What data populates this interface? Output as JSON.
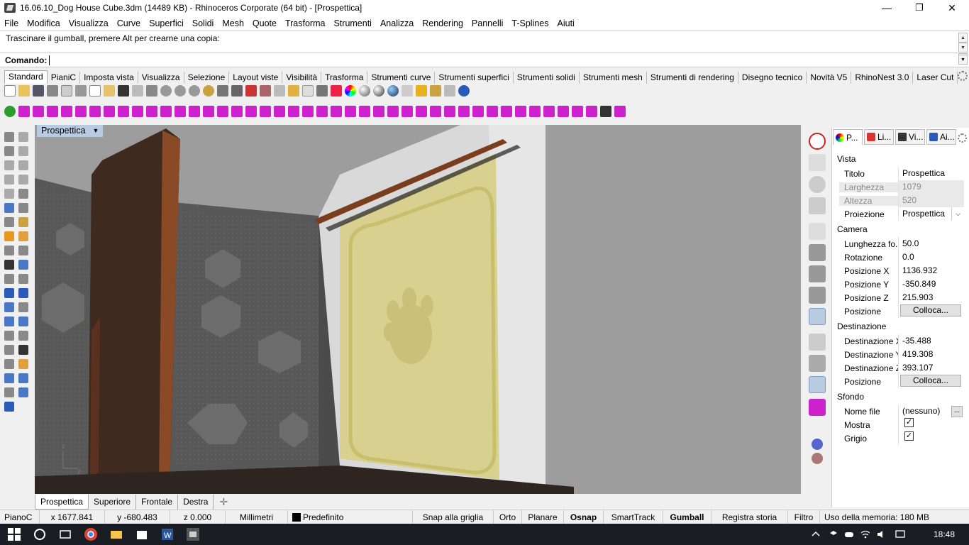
{
  "window": {
    "title": "16.06.10_Dog House Cube.3dm (14489 KB) - Rhinoceros Corporate (64 bit) - [Prospettica]",
    "minimize_glyph": "—",
    "restore_glyph": "❐",
    "close_glyph": "✕"
  },
  "menu": [
    "File",
    "Modifica",
    "Visualizza",
    "Curve",
    "Superfici",
    "Solidi",
    "Mesh",
    "Quote",
    "Trasforma",
    "Strumenti",
    "Analizza",
    "Rendering",
    "Pannelli",
    "T-Splines",
    "Aiuti"
  ],
  "command": {
    "history": "Trascinare il gumball, premere Alt per crearne una copia:",
    "prompt_label": "Comando:",
    "value": ""
  },
  "toolbar_tabs": [
    "Standard",
    "PianiC",
    "Imposta vista",
    "Visualizza",
    "Selezione",
    "Layout viste",
    "Visibilità",
    "Trasforma",
    "Strumenti curve",
    "Strumenti superfici",
    "Strumenti solidi",
    "Strumenti mesh",
    "Strumenti di rendering",
    "Disegno tecnico",
    "Novità V5",
    "RhinoNest 3.0",
    "Laser Cut"
  ],
  "viewport": {
    "label": "Prospettica",
    "axis_z": "z",
    "axis_y": "y"
  },
  "viewport_tabs": [
    "Prospettica",
    "Superiore",
    "Frontale",
    "Destra"
  ],
  "panel": {
    "tabs": [
      "P...",
      "Li...",
      "Vi...",
      "Ai..."
    ],
    "sections": {
      "vista": "Vista",
      "camera": "Camera",
      "destinazione": "Destinazione",
      "sfondo": "Sfondo"
    },
    "titolo": {
      "label": "Titolo",
      "value": "Prospettica"
    },
    "larghezza": {
      "label": "Larghezza",
      "value": "1079"
    },
    "altezza": {
      "label": "Altezza",
      "value": "520"
    },
    "proiezione": {
      "label": "Proiezione",
      "value": "Prospettica"
    },
    "lunghezza_focale": {
      "label": "Lunghezza fo...",
      "value": "50.0"
    },
    "rotazione": {
      "label": "Rotazione",
      "value": "0.0"
    },
    "pos_x": {
      "label": "Posizione X",
      "value": "1136.932"
    },
    "pos_y": {
      "label": "Posizione Y",
      "value": "-350.849"
    },
    "pos_z": {
      "label": "Posizione Z",
      "value": "215.903"
    },
    "posizione": {
      "label": "Posizione",
      "button": "Colloca..."
    },
    "dest_x": {
      "label": "Destinazione X",
      "value": "-35.488"
    },
    "dest_y": {
      "label": "Destinazione Y",
      "value": "419.308"
    },
    "dest_z": {
      "label": "Destinazione Z",
      "value": "393.107"
    },
    "dest_posizione": {
      "label": "Posizione",
      "button": "Colloca..."
    },
    "nome_file": {
      "label": "Nome file",
      "value": "(nessuno)",
      "button": "..."
    },
    "mostra": {
      "label": "Mostra",
      "checked": true
    },
    "grigio": {
      "label": "Grigio",
      "checked": true
    }
  },
  "status": {
    "cplane": "PianoC",
    "x": "x 1677.841",
    "y": "y -680.483",
    "z": "z 0.000",
    "units": "Millimetri",
    "layer": "Predefinito",
    "snap": "Snap alla griglia",
    "orto": "Orto",
    "planare": "Planare",
    "osnap": "Osnap",
    "smarttrack": "SmartTrack",
    "gumball": "Gumball",
    "registra": "Registra storia",
    "filtro": "Filtro",
    "memoria": "Uso della memoria: 180 MB"
  },
  "taskbar": {
    "clock": "18:48"
  },
  "colors": {
    "accent_tab": "#b8cbe1",
    "viewport_bg": "#9d9d9d",
    "door_yellow": "#d8d08a",
    "wood": "#7a3e1e",
    "taskbar": "#1a1d23"
  }
}
